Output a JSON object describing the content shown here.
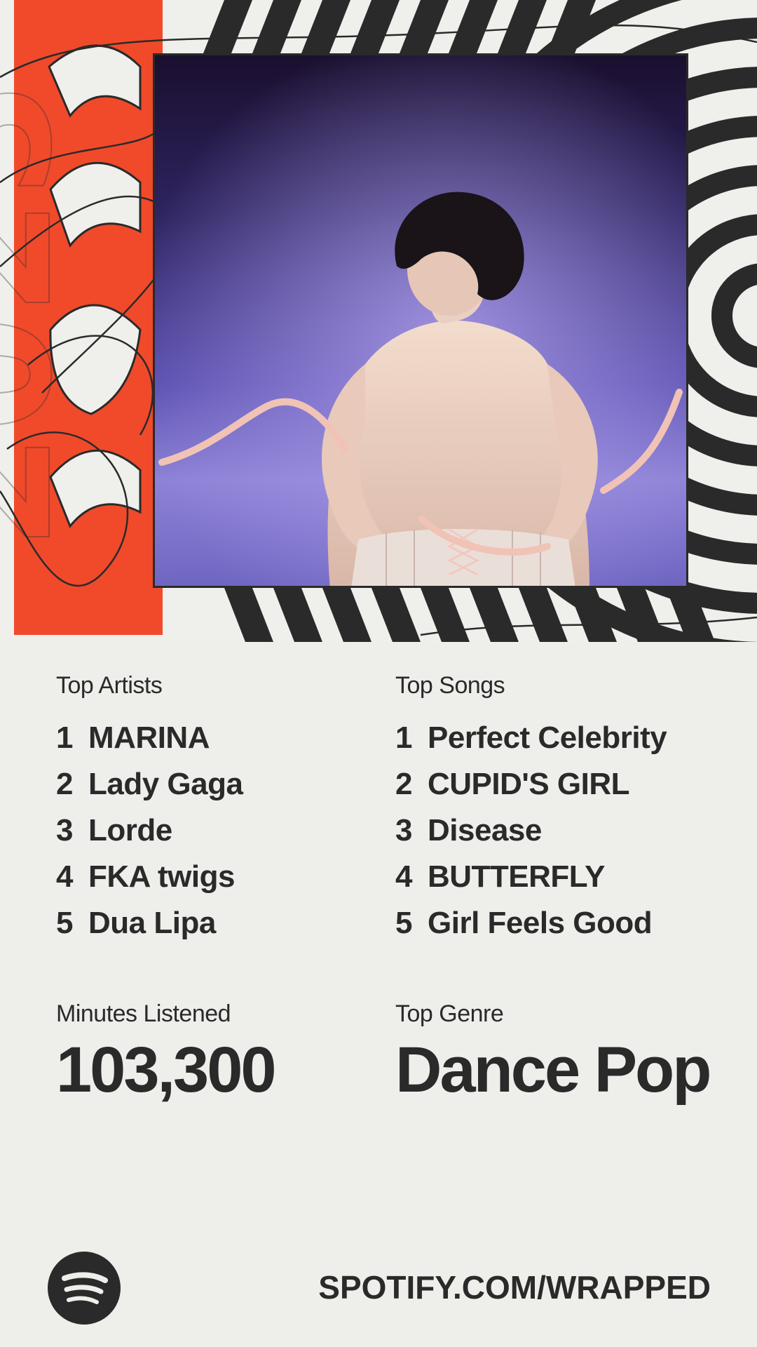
{
  "hero": {
    "year": "2025",
    "accent_color": "#f04a2b",
    "stripe_color": "#2a2a2a",
    "album_art": "woman-in-corset-with-ribbons-on-purple-background"
  },
  "top_artists": {
    "title": "Top Artists",
    "items": [
      {
        "rank": "1",
        "name": "MARINA"
      },
      {
        "rank": "2",
        "name": "Lady Gaga"
      },
      {
        "rank": "3",
        "name": "Lorde"
      },
      {
        "rank": "4",
        "name": "FKA twigs"
      },
      {
        "rank": "5",
        "name": "Dua Lipa"
      }
    ]
  },
  "top_songs": {
    "title": "Top Songs",
    "items": [
      {
        "rank": "1",
        "name": "Perfect Celebrity"
      },
      {
        "rank": "2",
        "name": "CUPID'S GIRL"
      },
      {
        "rank": "3",
        "name": "Disease"
      },
      {
        "rank": "4",
        "name": "BUTTERFLY"
      },
      {
        "rank": "5",
        "name": "Girl Feels Good"
      }
    ]
  },
  "minutes": {
    "title": "Minutes Listened",
    "value": "103,300"
  },
  "genre": {
    "title": "Top Genre",
    "value": "Dance Pop"
  },
  "footer": {
    "logo": "spotify-logo-icon",
    "url": "SPOTIFY.COM/WRAPPED"
  }
}
